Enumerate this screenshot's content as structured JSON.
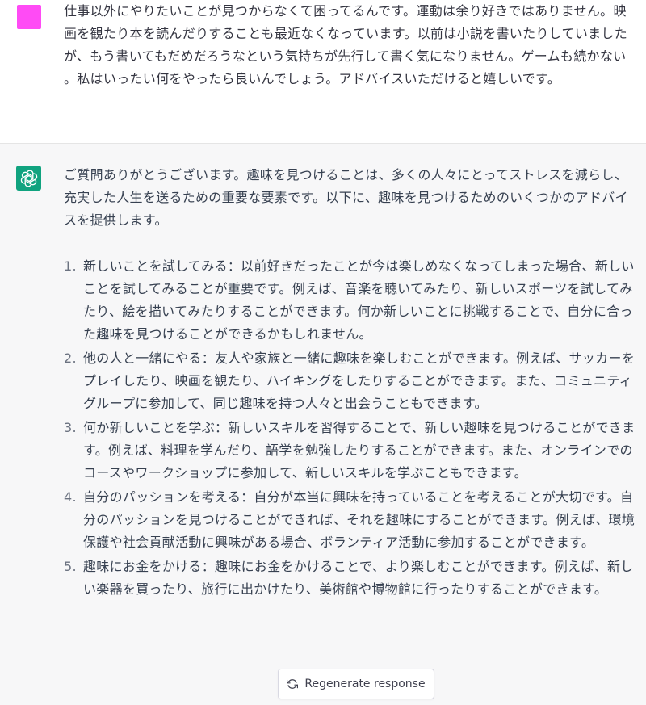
{
  "colors": {
    "user_avatar": "#ff4bf5",
    "bot_avatar": "#10a37f",
    "assistant_bg": "#f7f7f8",
    "text": "#374151"
  },
  "user": {
    "avatar_icon": "user-avatar-square",
    "message": "仕事以外にやりたいことが見つからなくて困ってるんです。運動は余り好きではありません。映画を観たり本を読んだりすることも最近なくなっています。以前は小説を書いたりしていましたが、もう書いてもだめだろうなという気持ちが先行して書く気になりません。ゲームも続かない。私はいったい何をやったら良いんでしょう。アドバイスいただけると嬉しいです。"
  },
  "assistant": {
    "avatar_icon": "openai-logo-icon",
    "intro": "ご質問ありがとうございます。趣味を見つけることは、多くの人々にとってストレスを減らし、充実した人生を送るための重要な要素です。以下に、趣味を見つけるためのいくつかのアドバイスを提供します。",
    "items": [
      {
        "num": "1.",
        "text": "新しいことを試してみる：以前好きだったことが今は楽しめなくなってしまった場合、新しいことを試してみることが重要です。例えば、音楽を聴いてみたり、新しいスポーツを試してみたり、絵を描いてみたりすることができます。何か新しいことに挑戦することで、自分に合った趣味を見つけることができるかもしれません。"
      },
      {
        "num": "2.",
        "text": "他の人と一緒にやる：友人や家族と一緒に趣味を楽しむことができます。例えば、サッカーをプレイしたり、映画を観たり、ハイキングをしたりすることができます。また、コミュニティグループに参加して、同じ趣味を持つ人々と出会うこともできます。"
      },
      {
        "num": "3.",
        "text": "何か新しいことを学ぶ：新しいスキルを習得することで、新しい趣味を見つけることができます。例えば、料理を学んだり、語学を勉強したりすることができます。また、オンラインでのコースやワークショップに参加して、新しいスキルを学ぶこともできます。"
      },
      {
        "num": "4.",
        "text": "自分のパッションを考える：自分が本当に興味を持っていることを考えることが大切です。自分のパッションを見つけることができれば、それを趣味にすることができます。例えば、環境保護や社会貢献活動に興味がある場合、ボランティア活動に参加することができます。"
      },
      {
        "num": "5.",
        "text": "趣味にお金をかける：趣味にお金をかけることで、より楽しむことができます。例えば、新しい楽器を買ったり、旅行に出かけたり、美術館や博物館に行ったりすることができます。"
      }
    ]
  },
  "regenerate": {
    "icon": "refresh-icon",
    "label": "Regenerate response"
  }
}
